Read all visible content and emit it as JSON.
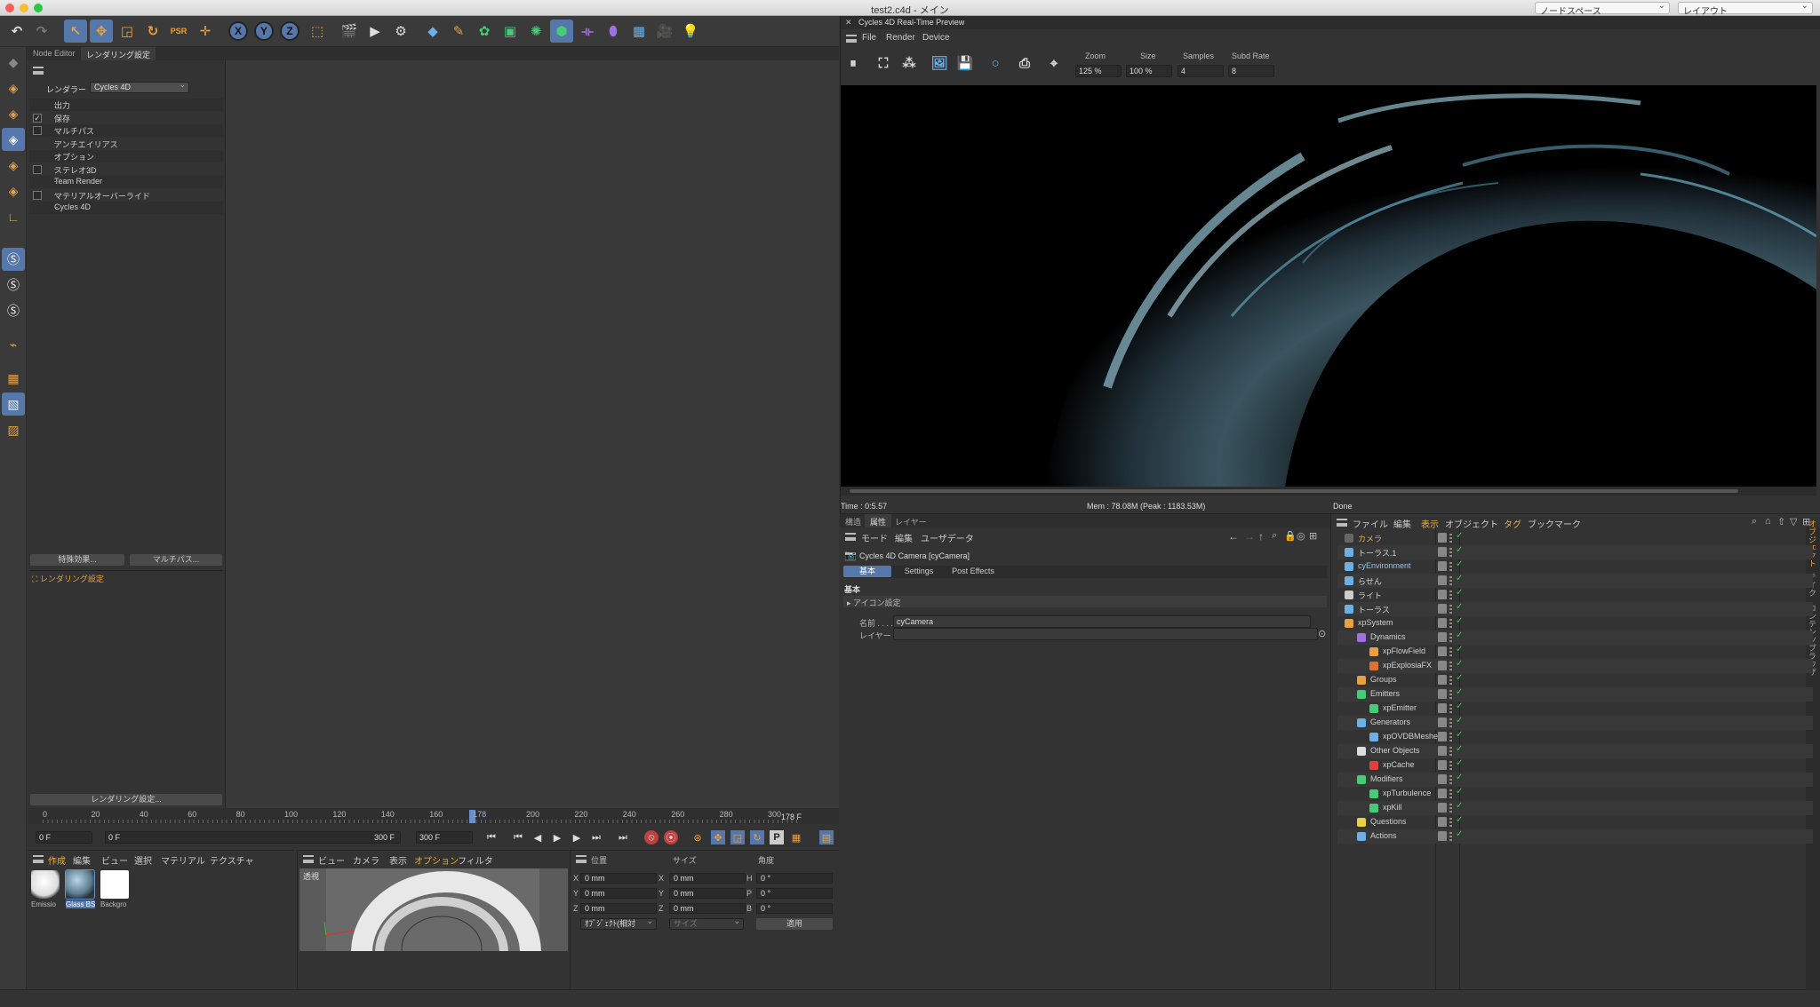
{
  "window": {
    "title": "test2.c4d - メイン",
    "nodespace": "ノードスペース",
    "layout": "レイアウト"
  },
  "left_panel": {
    "tabs": [
      "Node Editor",
      "レンダリング設定"
    ],
    "renderer_label": "レンダラー",
    "renderer_value": "Cycles 4D",
    "items": [
      {
        "label": "出力",
        "checkbox": false,
        "checked": false
      },
      {
        "label": "保存",
        "checkbox": true,
        "checked": true
      },
      {
        "label": "マルチパス",
        "checkbox": true,
        "checked": false
      },
      {
        "label": "アンチエイリアス",
        "checkbox": false,
        "checked": false
      },
      {
        "label": "オプション",
        "checkbox": false,
        "checked": false
      },
      {
        "label": "ステレオ3D",
        "checkbox": true,
        "checked": false
      },
      {
        "label": "Team Render",
        "checkbox": false,
        "checked": false
      },
      {
        "label": "マテリアルオーバーライド",
        "checkbox": true,
        "checked": false
      },
      {
        "label": "Cycles 4D",
        "checkbox": false,
        "checked": false
      }
    ],
    "effects_button": "特殊効果...",
    "multipass_button": "マルチパス...",
    "render_setting_item": "レンダリング設定",
    "render_settings_button": "レンダリング設定..."
  },
  "timeline": {
    "ticks": [
      "0",
      "20",
      "40",
      "60",
      "80",
      "100",
      "120",
      "140",
      "160",
      "178",
      "200",
      "220",
      "240",
      "260",
      "280",
      "300"
    ],
    "current_frame": "178 F",
    "start": "0 F",
    "start2": "0 F",
    "end": "300 F",
    "end2": "300 F"
  },
  "materials_panel": {
    "menu": [
      "作成",
      "編集",
      "ビュー",
      "選択",
      "マテリアル",
      "テクスチャ"
    ],
    "materials": [
      "Emissio",
      "Glass BS",
      "Backgro"
    ]
  },
  "mini_viewport": {
    "menu": [
      "ビュー",
      "カメラ",
      "表示",
      "オプション",
      "フィルタ"
    ],
    "label": "透視"
  },
  "coords_panel": {
    "headers": [
      "位置",
      "サイズ",
      "角度"
    ],
    "rows": [
      {
        "a": "X",
        "pos": "0 mm",
        "b": "X",
        "size": "0 mm",
        "c": "H",
        "rot": "0 °"
      },
      {
        "a": "Y",
        "pos": "0 mm",
        "b": "Y",
        "size": "0 mm",
        "c": "P",
        "rot": "0 °"
      },
      {
        "a": "Z",
        "pos": "0 mm",
        "b": "Z",
        "size": "0 mm",
        "c": "B",
        "rot": "0 °"
      }
    ],
    "mode_select": "ｵﾌﾞｼﾞｪｸﾄ(相対",
    "size_select": "サイズ",
    "apply": "適用"
  },
  "preview": {
    "title": "Cycles 4D Real-Time Preview",
    "menu": [
      "File",
      "Render",
      "Device"
    ],
    "zoom_label": "Zoom",
    "zoom": "125 %",
    "size_label": "Size",
    "size": "100 %",
    "samples_label": "Samples",
    "samples": "4",
    "subd_label": "Subd Rate",
    "subd": "8",
    "time": "Time : 0:5.57",
    "mem": "Mem : 78.08M (Peak : 1183.53M)",
    "status": "Done"
  },
  "attributes": {
    "tabs": [
      "構造",
      "属性",
      "レイヤー"
    ],
    "menu": [
      "モード",
      "編集",
      "ユーザデータ"
    ],
    "object_title": "Cycles 4D Camera [cyCamera]",
    "subtabs": [
      "基本",
      "Settings",
      "Post Effects"
    ],
    "section": "基本",
    "icon_settings": "アイコン設定",
    "name_label": "名前 . . . .",
    "name_value": "cyCamera",
    "layer_label": "レイヤー"
  },
  "objects": {
    "menu": [
      "ファイル",
      "編集",
      "表示",
      "オブジェクト",
      "タグ",
      "ブックマーク"
    ],
    "side_tabs": [
      "オブジェクト",
      "テイク",
      "コンテンツブラウザ"
    ],
    "rows": [
      {
        "name": "カメラ",
        "indent": 0,
        "color": "#e8b040",
        "icon": "#666",
        "alt": false
      },
      {
        "name": "トーラス.1",
        "indent": 0,
        "color": "#d0d0d0",
        "icon": "#6cb0e6",
        "alt": true
      },
      {
        "name": "cyEnvironment",
        "indent": 0,
        "color": "#8ac8ff",
        "icon": "#6cb0e6",
        "alt": false
      },
      {
        "name": "らせん",
        "indent": 0,
        "color": "#d0d0d0",
        "icon": "#6cb0e6",
        "alt": true
      },
      {
        "name": "ライト",
        "indent": 0,
        "color": "#d0d0d0",
        "icon": "#ccc",
        "alt": false
      },
      {
        "name": "トーラス",
        "indent": 0,
        "color": "#d0d0d0",
        "icon": "#6cb0e6",
        "alt": true
      },
      {
        "name": "xpSystem",
        "indent": 0,
        "color": "#d0d0d0",
        "icon": "#e8a040",
        "alt": false
      },
      {
        "name": "Dynamics",
        "indent": 1,
        "color": "#d0d0d0",
        "icon": "#a070e0",
        "alt": true
      },
      {
        "name": "xpFlowField",
        "indent": 2,
        "color": "#d0d0d0",
        "icon": "#e8a040",
        "alt": false
      },
      {
        "name": "xpExplosiaFX",
        "indent": 2,
        "color": "#d0d0d0",
        "icon": "#e07030",
        "alt": true
      },
      {
        "name": "Groups",
        "indent": 1,
        "color": "#d0d0d0",
        "icon": "#e8a040",
        "alt": false
      },
      {
        "name": "Emitters",
        "indent": 1,
        "color": "#d0d0d0",
        "icon": "#44cc77",
        "alt": true
      },
      {
        "name": "xpEmitter",
        "indent": 2,
        "color": "#d0d0d0",
        "icon": "#44cc77",
        "alt": false
      },
      {
        "name": "Generators",
        "indent": 1,
        "color": "#d0d0d0",
        "icon": "#6cb0e6",
        "alt": true
      },
      {
        "name": "xpOVDBMesher",
        "indent": 2,
        "color": "#d0d0d0",
        "icon": "#6cb0e6",
        "alt": false
      },
      {
        "name": "Other Objects",
        "indent": 1,
        "color": "#d0d0d0",
        "icon": "#ddd",
        "alt": true
      },
      {
        "name": "xpCache",
        "indent": 2,
        "color": "#d0d0d0",
        "icon": "#e04040",
        "alt": false
      },
      {
        "name": "Modifiers",
        "indent": 1,
        "color": "#d0d0d0",
        "icon": "#44cc77",
        "alt": true
      },
      {
        "name": "xpTurbulence",
        "indent": 2,
        "color": "#d0d0d0",
        "icon": "#44cc77",
        "alt": false
      },
      {
        "name": "xpKill",
        "indent": 2,
        "color": "#d0d0d0",
        "icon": "#44cc77",
        "alt": true
      },
      {
        "name": "Questions",
        "indent": 1,
        "color": "#d0d0d0",
        "icon": "#e8d040",
        "alt": false
      },
      {
        "name": "Actions",
        "indent": 1,
        "color": "#d0d0d0",
        "icon": "#6cb0e6",
        "alt": true
      }
    ]
  },
  "colors": {
    "accent": "#5577aa",
    "orange": "#e8a040",
    "active_tab": "#e8b040"
  }
}
